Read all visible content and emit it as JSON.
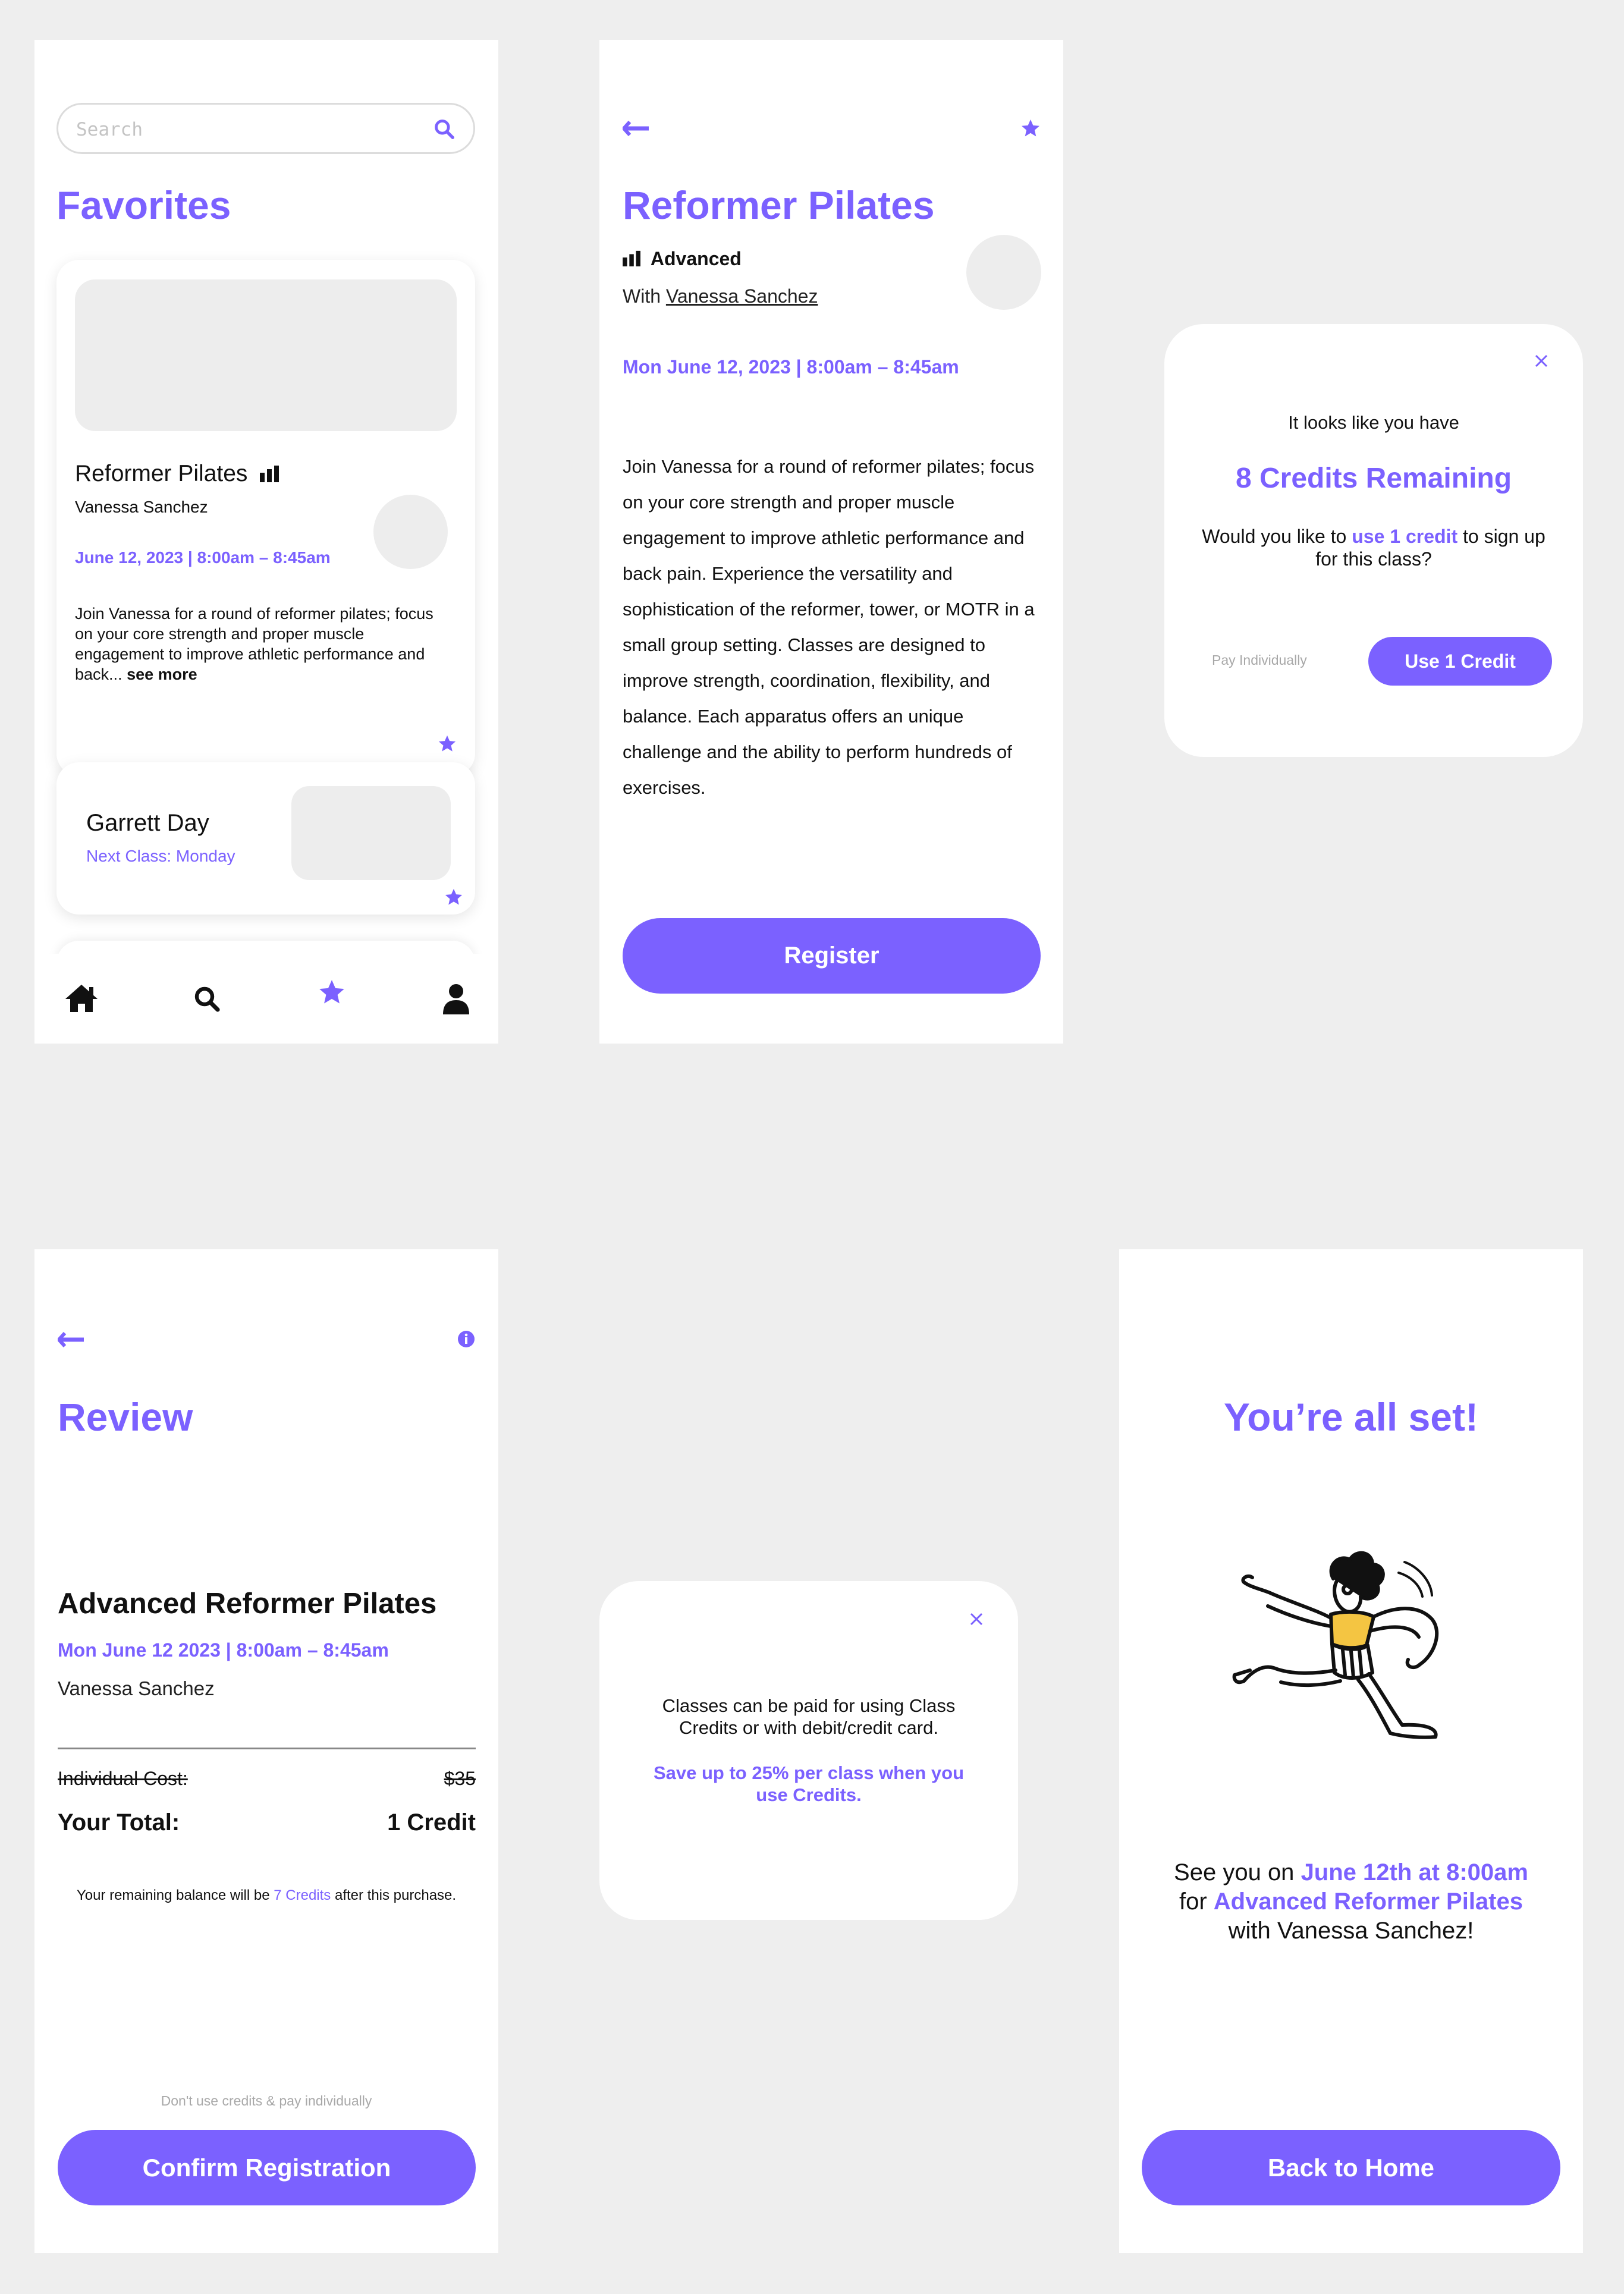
{
  "colors": {
    "accent": "#7b61ff",
    "background": "#eeeeee",
    "placeholder": "#ededed",
    "illustration_yellow": "#f4c542"
  },
  "favorites_screen": {
    "search": {
      "placeholder": "Search",
      "icon": "search-icon"
    },
    "title": "Favorites",
    "card1": {
      "title": "Reformer Pilates",
      "level_icon": "level-bars-icon",
      "instructor": "Vanessa Sanchez",
      "datetime": "June 12, 2023 | 8:00am – 8:45am",
      "description": "Join Vanessa for a round of reformer pilates; focus on your core strength and proper muscle engagement to improve athletic performance and back...",
      "see_more": "see more",
      "favorite_icon": "star-icon"
    },
    "card2": {
      "name": "Garrett Day",
      "next_class": "Next Class: Monday",
      "favorite_icon": "star-icon"
    },
    "nav": {
      "home": "home-icon",
      "search": "search-icon",
      "favorites": "star-icon",
      "profile": "user-icon"
    }
  },
  "class_detail_screen": {
    "title": "Reformer Pilates",
    "level": "Advanced",
    "with_prefix": "With",
    "instructor": "Vanessa Sanchez",
    "datetime": "Mon June 12, 2023 | 8:00am – 8:45am",
    "description": "Join Vanessa for a round of reformer pilates; focus on your core strength and proper muscle engagement to improve athletic performance and back pain. Experience the versatility and sophistication of the reformer, tower, or MOTR in a small group setting. Classes are designed to improve strength, coordination, flexibility, and balance. Each apparatus offers an unique challenge and the ability to perform hundreds of exercises.",
    "register_button": "Register"
  },
  "credits_modal": {
    "line1": "It looks like you have",
    "credits": "8 Credits Remaining",
    "question_prefix": "Would you like to",
    "question_link": "use 1 credit",
    "question_suffix": "to sign up for this class?",
    "pay_individually": "Pay Individually",
    "use_credit_button": "Use 1 Credit"
  },
  "review_screen": {
    "title": "Review",
    "class_name": "Advanced Reformer Pilates",
    "datetime": "Mon June 12 2023 | 8:00am – 8:45am",
    "instructor": "Vanessa Sanchez",
    "individual_cost_label": "Individual Cost:",
    "individual_cost_value": "$35",
    "total_label": "Your Total:",
    "total_value": "1 Credit",
    "balance_prefix": "Your remaining balance will be",
    "balance_credits": "7 Credits",
    "balance_suffix": "after this purchase.",
    "pay_individually_link": "Don't use credits & pay individually",
    "confirm_button": "Confirm Registration"
  },
  "info_modal": {
    "text": "Classes can be paid for using Class Credits or with debit/credit card.",
    "highlight": "Save up to 25% per class when you use Credits."
  },
  "success_screen": {
    "title": "You’re all set!",
    "line1_prefix": "See you on",
    "line1_highlight": "June 12th at 8:00am",
    "line2_prefix": "for",
    "line2_highlight": "Advanced Reformer Pilates",
    "line3": "with Vanessa Sanchez!",
    "home_button": "Back to Home"
  }
}
